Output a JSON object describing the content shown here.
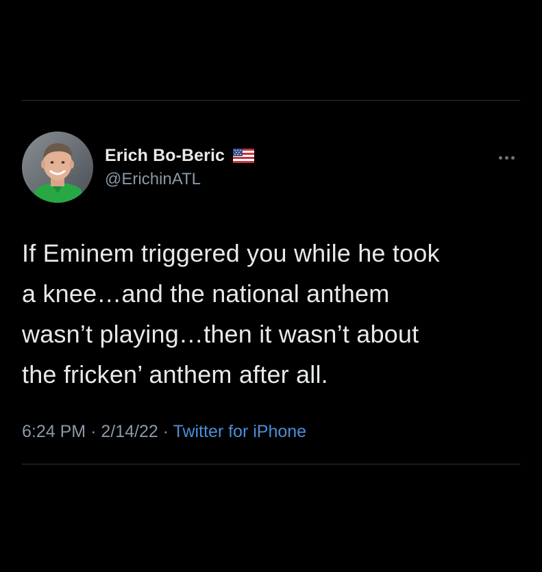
{
  "tweet": {
    "author": {
      "display_name": "Erich Bo-Beric",
      "handle": "@ErichinATL",
      "badge_icon": "us-flag-icon",
      "avatar_icon": "profile-photo"
    },
    "more_icon": "more-options-icon",
    "text_lines": [
      "If Eminem triggered you while he took",
      "a knee…and the national anthem",
      "wasn’t playing…then it wasn’t about",
      "the fricken’ anthem after all."
    ],
    "time": "6:24 PM",
    "separator": "·",
    "date": "2/14/22",
    "source": "Twitter for iPhone"
  },
  "colors": {
    "background": "#000000",
    "text": "#e7e9ea",
    "secondary": "#8b98a5",
    "link": "#4c8ed6",
    "divider": "#2f3336"
  }
}
